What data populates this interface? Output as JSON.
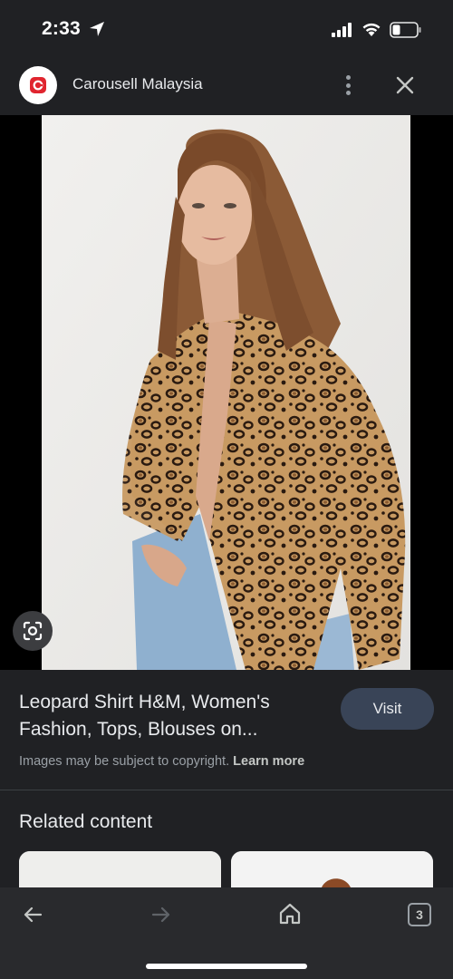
{
  "status_bar": {
    "time": "2:33",
    "icons": [
      "location-arrow-icon",
      "cellular-signal-icon",
      "wifi-icon",
      "battery-icon"
    ]
  },
  "header": {
    "site_name": "Carousell Malaysia",
    "logo_icon": "carousell-logo-icon",
    "menu_icon": "more-vert-icon",
    "close_icon": "close-icon"
  },
  "image": {
    "subject": "leopard-print shirt photo",
    "lens_icon": "google-lens-icon"
  },
  "result": {
    "title": "Leopard Shirt H&M, Women's Fashion, Tops, Blouses on...",
    "visit_label": "Visit",
    "copyright_text": "Images may be subject to copyright.",
    "learn_more": "Learn more"
  },
  "related": {
    "title": "Related content"
  },
  "bottom_nav": {
    "back_icon": "arrow-back-icon",
    "forward_icon": "arrow-forward-icon",
    "home_icon": "home-icon",
    "tab_count": "3"
  },
  "colors": {
    "background": "#202124",
    "visit_button": "#394457",
    "brand_red": "#e0252f"
  }
}
